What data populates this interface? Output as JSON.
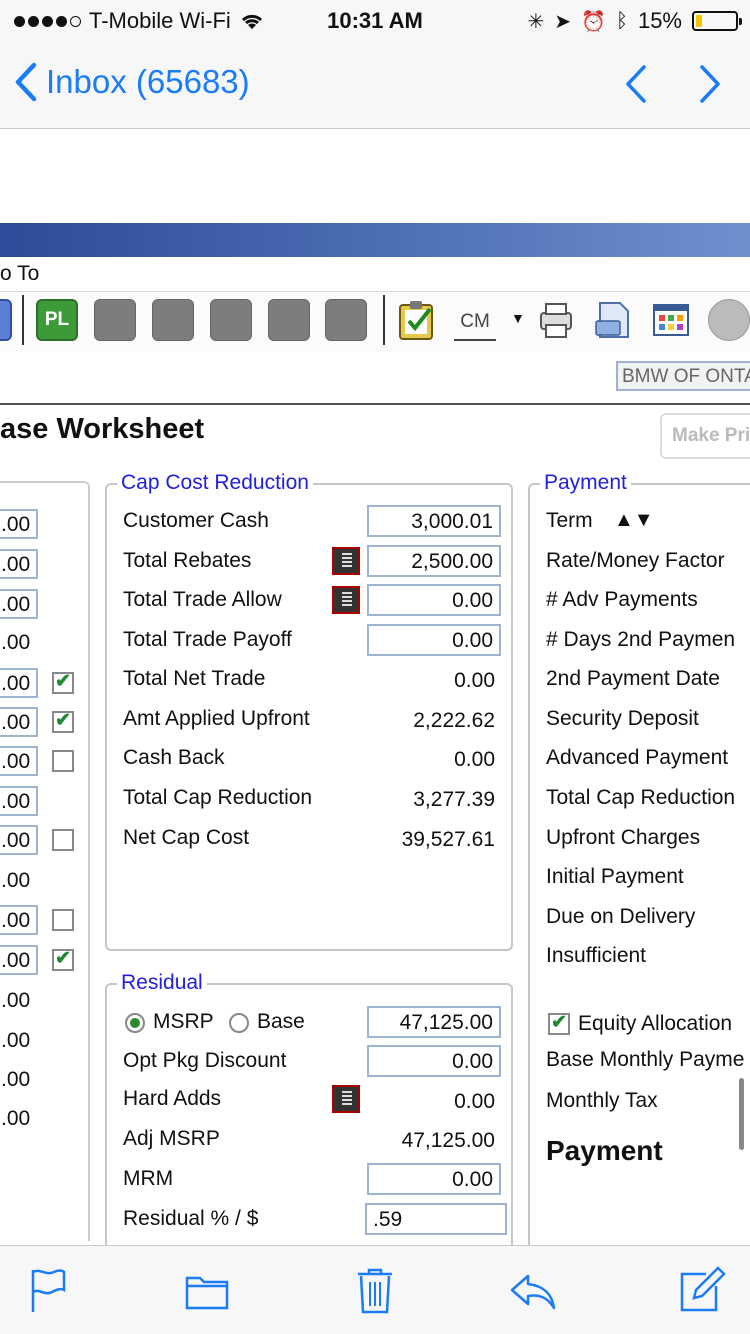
{
  "status_bar": {
    "carrier": "T-Mobile Wi-Fi",
    "time": "10:31 AM",
    "battery": "15%",
    "battery_level": 0.15
  },
  "nav": {
    "back_label": "Inbox (65683)"
  },
  "app": {
    "menu_item": "o To",
    "toolbar_pl": "PL",
    "toolbar_cm": "CM",
    "dealer": "BMW OF ONTA",
    "heading": "ase Worksheet",
    "make_button": "Make Pri"
  },
  "left_column": {
    "values": [
      ".00",
      ".00",
      ".00",
      ".00",
      ".00",
      ".00",
      ".00",
      ".00",
      ".00",
      ".00",
      ".00",
      ".00",
      ".00",
      ".00",
      ".00",
      ".00"
    ],
    "checkboxes": [
      true,
      true,
      false,
      false,
      false,
      true
    ]
  },
  "cap_cost_reduction": {
    "legend": "Cap Cost Reduction",
    "rows": [
      {
        "label": "Customer Cash",
        "value": "3,000.01"
      },
      {
        "label": "Total Rebates",
        "value": "2,500.00"
      },
      {
        "label": "Total Trade Allow",
        "value": "0.00"
      },
      {
        "label": "Total Trade Payoff",
        "value": "0.00"
      },
      {
        "label": "Total Net Trade",
        "value": "0.00"
      },
      {
        "label": "Amt Applied Upfront",
        "value": "2,222.62"
      },
      {
        "label": "Cash Back",
        "value": "0.00"
      },
      {
        "label": "Total Cap Reduction",
        "value": "3,277.39"
      },
      {
        "label": "Net Cap Cost",
        "value": "39,527.61"
      }
    ]
  },
  "residual": {
    "legend": "Residual",
    "radio_msrp": "MSRP",
    "radio_base": "Base",
    "rows": [
      {
        "label": "",
        "value": "47,125.00"
      },
      {
        "label": "Opt Pkg Discount",
        "value": "0.00"
      },
      {
        "label": "Hard Adds",
        "value": "0.00"
      },
      {
        "label": "Adj MSRP",
        "value": "47,125.00"
      },
      {
        "label": "MRM",
        "value": "0.00"
      },
      {
        "label": "Residual % / $",
        "value": ".59"
      }
    ]
  },
  "payment": {
    "legend": "Payment",
    "rows": [
      "Term",
      "Rate/Money Factor",
      "# Adv Payments",
      "# Days 2nd Paymen",
      "2nd Payment Date",
      "Security Deposit",
      "Advanced Payment",
      "Total Cap Reduction",
      "Upfront Charges",
      "Initial Payment",
      "Due on Delivery",
      "Insufficient"
    ],
    "equity_allocation": "Equity Allocation",
    "base_monthly": "Base Monthly Payme",
    "monthly_tax": "Monthly Tax",
    "payment_label": "Payment"
  },
  "colors": {
    "ios_blue": "#1a7cf6",
    "legend_blue": "#2020dd",
    "field_border": "#9db3cf"
  }
}
